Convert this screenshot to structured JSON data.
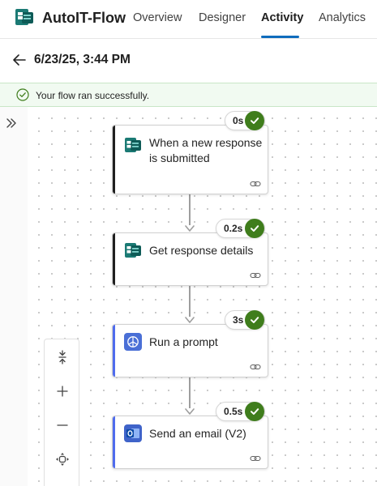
{
  "app": {
    "title": "AutoIT-Flow",
    "logo_icon": "power-automate-logo",
    "accent_color": "#0f6cbd"
  },
  "tabs": [
    {
      "label": "Overview",
      "active": false
    },
    {
      "label": "Designer",
      "active": false
    },
    {
      "label": "Activity",
      "active": true
    },
    {
      "label": "Analytics",
      "active": false
    }
  ],
  "run": {
    "title": "6/23/25, 3:44 PM"
  },
  "banner": {
    "text": "Your flow ran successfully.",
    "color": "#f1faf1",
    "icon": "success-check-icon"
  },
  "steps": [
    {
      "title": "When a new response is submitted",
      "duration": "0s",
      "status": "succeeded",
      "icon": "forms-icon",
      "accent": "#1f1f1f"
    },
    {
      "title": "Get response details",
      "duration": "0.2s",
      "status": "succeeded",
      "icon": "forms-icon",
      "accent": "#1f1f1f"
    },
    {
      "title": "Run a prompt",
      "duration": "3s",
      "status": "succeeded",
      "icon": "ai-prompt-icon",
      "accent": "#4f6bed"
    },
    {
      "title": "Send an email (V2)",
      "duration": "0.5s",
      "status": "succeeded",
      "icon": "outlook-icon",
      "accent": "#4f6bed"
    }
  ],
  "zoom_controls": [
    "fit-vertical-icon",
    "zoom-in-icon",
    "zoom-out-icon",
    "fit-view-icon"
  ],
  "status_color": "#3f7d1c"
}
